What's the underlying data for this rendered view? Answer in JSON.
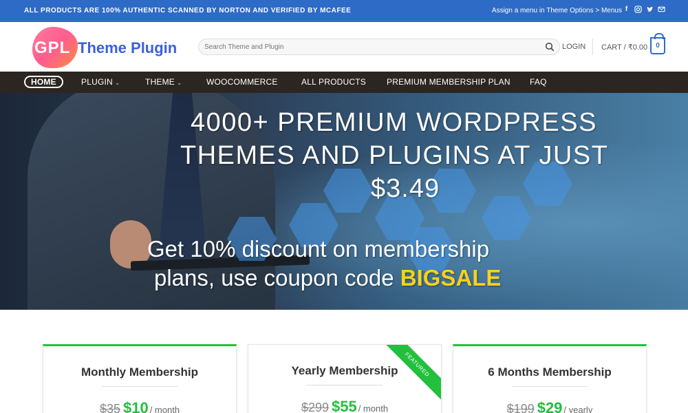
{
  "topbar": {
    "announcement": "ALL PRODUCTS ARE 100% AUTHENTIC SCANNED BY NORTON AND VERIFIED BY MCAFEE",
    "assign_menu": "Assign a menu in Theme Options > Menus",
    "socials": [
      "facebook-icon",
      "instagram-icon",
      "twitter-icon",
      "email-icon"
    ]
  },
  "header": {
    "logo_badge": "GPL",
    "logo_text": "Theme Plugin",
    "search_placeholder": "Search Theme and Plugin",
    "login": "LOGIN",
    "cart_label": "CART / ₹0.00",
    "cart_count": "0"
  },
  "nav": {
    "items": [
      {
        "label": "HOME"
      },
      {
        "label": "PLUGIN"
      },
      {
        "label": "THEME"
      },
      {
        "label": "WOOCOMMERCE"
      },
      {
        "label": "ALL PRODUCTS"
      },
      {
        "label": "PREMIUM MEMBERSHIP PLAN"
      },
      {
        "label": "FAQ"
      }
    ]
  },
  "hero": {
    "line1": "4000+ PREMIUM WORDPRESS",
    "line2": "THEMES AND PLUGINS AT JUST",
    "line3": "$3.49",
    "line4": "Get 10% discount on membership",
    "line5_prefix": "plans, use coupon code ",
    "coupon": "BIGSALE"
  },
  "plans": [
    {
      "title": "Monthly Membership",
      "old_price": "$35",
      "new_price": "$10",
      "period": "/ month"
    },
    {
      "title": "Yearly Membership",
      "old_price": "$299",
      "new_price": "$55",
      "period": "/ month",
      "ribbon": "FEATURED"
    },
    {
      "title": "6 Months Membership",
      "old_price": "$199",
      "new_price": "$29",
      "period": "/ yearly"
    }
  ],
  "colors": {
    "topbar": "#2d6bc7",
    "nav": "#2b2621",
    "accent_green": "#22c03d",
    "coupon_yellow": "#f7d21b"
  }
}
